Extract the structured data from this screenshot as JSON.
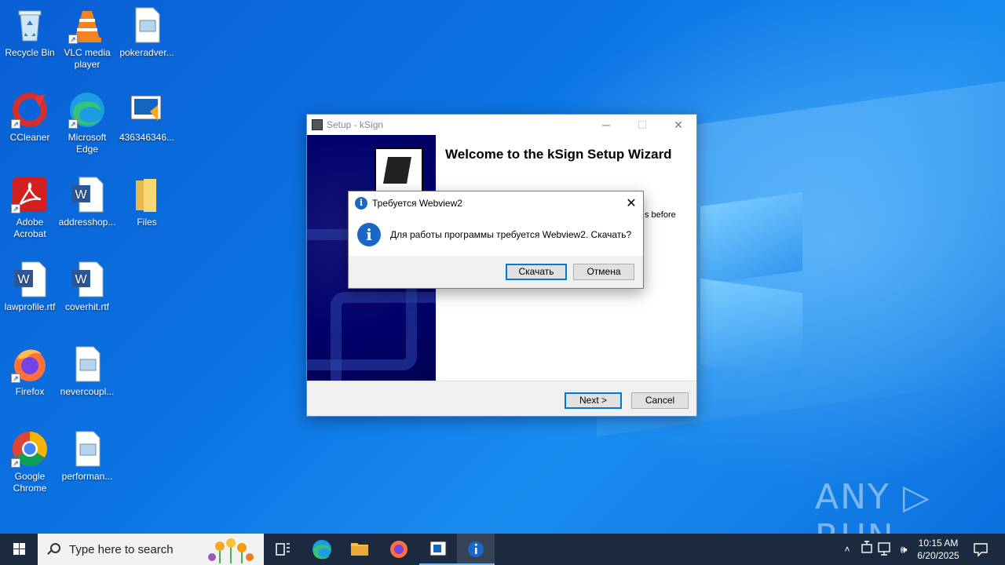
{
  "desktop": {
    "icons": [
      {
        "label": "Recycle Bin",
        "icon": "recycle-bin-icon"
      },
      {
        "label": "VLC media player",
        "icon": "vlc-icon"
      },
      {
        "label": "pokeradver...",
        "icon": "image-file-icon"
      },
      {
        "label": "CCleaner",
        "icon": "ccleaner-icon"
      },
      {
        "label": "Microsoft Edge",
        "icon": "edge-icon"
      },
      {
        "label": "436346346...",
        "icon": "installer-icon"
      },
      {
        "label": "Adobe Acrobat",
        "icon": "acrobat-icon"
      },
      {
        "label": "addresshop...",
        "icon": "word-doc-icon"
      },
      {
        "label": "Files",
        "icon": "folder-icon"
      },
      {
        "label": "lawprofile.rtf",
        "icon": "word-doc-icon"
      },
      {
        "label": "coverhit.rtf",
        "icon": "word-doc-icon"
      },
      {
        "label": "Firefox",
        "icon": "firefox-icon"
      },
      {
        "label": "nevercoupl...",
        "icon": "image-file-icon"
      },
      {
        "label": "Google Chrome",
        "icon": "chrome-icon"
      },
      {
        "label": "performan...",
        "icon": "image-file-icon"
      }
    ]
  },
  "setup_window": {
    "title": "Setup - kSign",
    "welcome": "Welcome to the kSign Setup Wizard",
    "partial_text": "s before",
    "next_label": "Next >",
    "cancel_label": "Cancel"
  },
  "message_box": {
    "title": "Требуется Webview2",
    "message": "Для работы программы требуется Webview2. Скачать?",
    "ok_label": "Скачать",
    "cancel_label": "Отмена",
    "info_glyph": "i"
  },
  "taskbar": {
    "search_placeholder": "Type here to search",
    "time": "10:15 AM",
    "date": "6/20/2025"
  },
  "watermark": "ANY ▷ RUN",
  "colors": {
    "desktop": "#0b74e3",
    "taskbar": "#1b2a3f",
    "accent": "#0078d7",
    "installer_panel": "#00006a"
  }
}
